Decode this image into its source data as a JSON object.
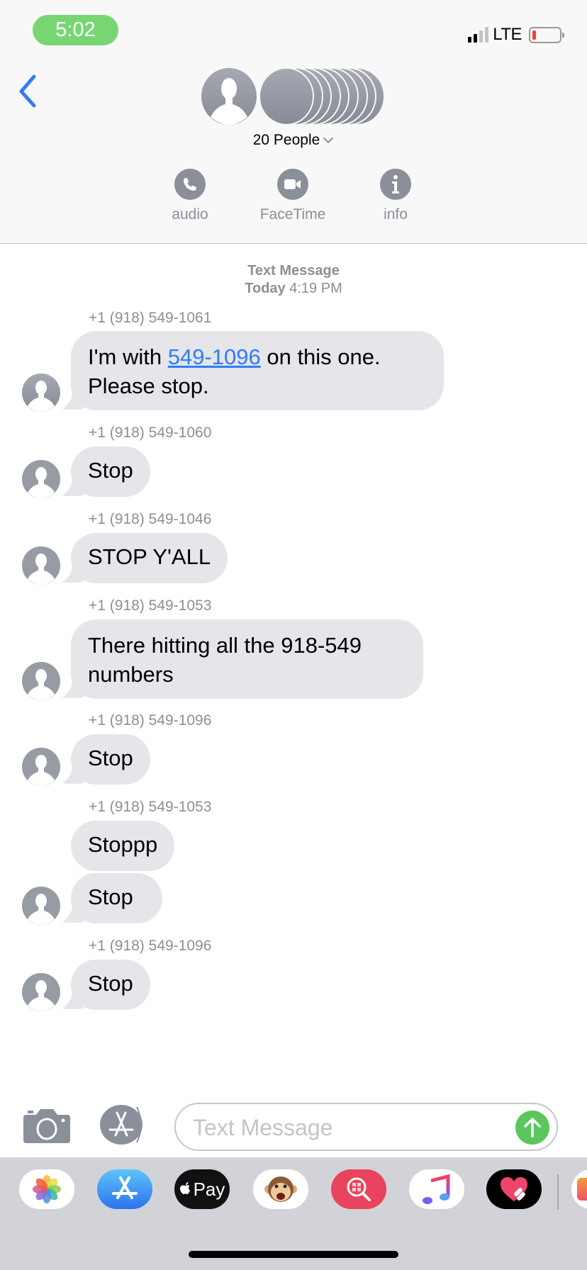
{
  "status_bar": {
    "time": "5:02",
    "network": "LTE",
    "signal_bars_active": 2,
    "signal_bars_total": 4,
    "battery_level": 0.08,
    "battery_color": "#ff3b30"
  },
  "header": {
    "back_icon": "chevron-left-icon",
    "group_name": "20 People",
    "participant_count": 20,
    "actions": [
      {
        "label": "audio",
        "icon": "phone-icon"
      },
      {
        "label": "FaceTime",
        "icon": "video-camera-icon"
      },
      {
        "label": "info",
        "icon": "info-icon"
      }
    ]
  },
  "thread": {
    "service_label": "Text Message",
    "date_label": "Today",
    "time_label": "4:19 PM",
    "messages": [
      {
        "sender": "+1 (918) 549-1061",
        "text_before": "I'm with ",
        "link": "549-1096",
        "text_after": " on this one.",
        "line2": "Please stop."
      },
      {
        "sender": "+1 (918) 549-1060",
        "text": "Stop"
      },
      {
        "sender": "+1 (918) 549-1046",
        "text": "STOP Y'ALL"
      },
      {
        "sender": "+1 (918) 549-1053",
        "text": "There hitting all the 918-549",
        "line2": "numbers"
      },
      {
        "sender": "+1 (918) 549-1096",
        "text": "Stop"
      },
      {
        "sender": "+1 (918) 549-1053",
        "text": "Stoppp"
      },
      {
        "sender": "",
        "text": "Stop"
      },
      {
        "sender": "+1 (918) 549-1096",
        "text": "Stop"
      }
    ]
  },
  "composer": {
    "placeholder": "Text Message",
    "value": "",
    "camera_icon": "camera-icon",
    "apps_icon": "app-store-icon",
    "send_icon": "arrow-up-icon",
    "send_color": "#5ac65c"
  },
  "app_drawer": {
    "apps": [
      {
        "name": "Photos"
      },
      {
        "name": "App Store"
      },
      {
        "name": "Apple Pay",
        "label": "Pay"
      },
      {
        "name": "Animoji"
      },
      {
        "name": "Images Search"
      },
      {
        "name": "Music"
      },
      {
        "name": "Digital Touch"
      },
      {
        "name": "More"
      }
    ]
  },
  "colors": {
    "link": "#2f7cf6",
    "bubble": "#e5e5ea",
    "meta_text": "#8e8e93",
    "back_blue": "#2f7cf6"
  }
}
